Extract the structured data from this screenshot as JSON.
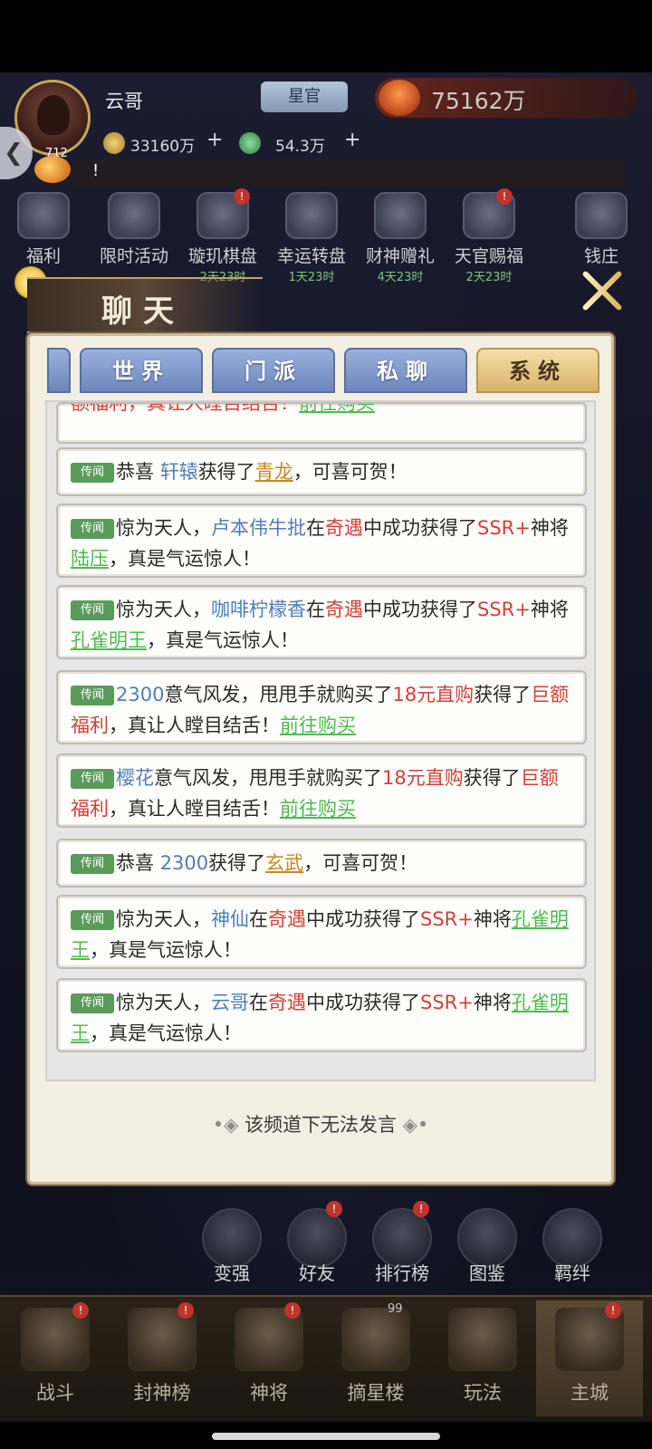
{
  "player": {
    "name": "云哥",
    "rank": "星官",
    "power": "75162万",
    "level": "712",
    "gold": "33160万",
    "jade": "54.3万",
    "marquee": "!"
  },
  "activities": [
    {
      "label": "福利",
      "timer": ""
    },
    {
      "label": "限时活动",
      "timer": ""
    },
    {
      "label": "璇玑棋盘",
      "timer": "2天23时"
    },
    {
      "label": "幸运转盘",
      "timer": "1天23时"
    },
    {
      "label": "财神赠礼",
      "timer": "4天23时"
    },
    {
      "label": "天官赐福",
      "timer": "2天23时"
    },
    {
      "label": "钱庄",
      "timer": ""
    }
  ],
  "chat": {
    "title": "聊天",
    "tabs": [
      "世界",
      "门派",
      "私聊",
      "系统"
    ],
    "active_tab": "系统",
    "tag": "传闻",
    "footer": "该频道下无法发言",
    "messages": [
      {
        "t1": "额福利，真让人瞠目结舌！",
        "link": "前往购买"
      },
      {
        "t1": "恭喜 ",
        "who": "轩辕",
        "t2": "获得了",
        "item": "青龙",
        "t3": "，可喜可贺！"
      },
      {
        "t1": "惊为天人，",
        "who": "卢本伟牛批",
        "t2": "在",
        "ev": "奇遇",
        "t3": "中成功获得了",
        "ssr": "SSR+",
        "t4": "神将",
        "item": "陆压",
        "t5": "，真是气运惊人！"
      },
      {
        "t1": "惊为天人，",
        "who": "咖啡柠檬香",
        "t2": "在",
        "ev": "奇遇",
        "t3": "中成功获得了",
        "ssr": "SSR+",
        "t4": "神将",
        "item": "孔雀明王",
        "t5": "，真是气运惊人！"
      },
      {
        "who": "2300",
        "t1": "意气风发，甩甩手就购买了",
        "pack": "18元直购",
        "t2": "获得了",
        "bonus": "巨额福利",
        "t3": "，真让人瞠目结舌！",
        "link": "前往购买"
      },
      {
        "who": "樱花",
        "t1": "意气风发，甩甩手就购买了",
        "pack": "18元直购",
        "t2": "获得了",
        "bonus": "巨额福利",
        "t3": "，真让人瞠目结舌！",
        "link": "前往购买"
      },
      {
        "t1": "恭喜 ",
        "who": "2300",
        "t2": "获得了",
        "item": "玄武",
        "t3": "，可喜可贺！"
      },
      {
        "t1": "惊为天人，",
        "who": "神仙",
        "t2": "在",
        "ev": "奇遇",
        "t3": "中成功获得了",
        "ssr": "SSR+",
        "t4": "神将",
        "item": "孔雀明王",
        "t5": "，真是气运惊人！"
      },
      {
        "t1": "惊为天人，",
        "who": "云哥",
        "t2": "在",
        "ev": "奇遇",
        "t3": "中成功获得了",
        "ssr": "SSR+",
        "t4": "神将",
        "item": "孔雀明王",
        "t5": "，真是气运惊人！"
      }
    ]
  },
  "shortcuts": [
    "变强",
    "好友",
    "排行榜",
    "图鉴",
    "羁绊"
  ],
  "nav": [
    {
      "label": "战斗"
    },
    {
      "label": "封神榜"
    },
    {
      "label": "神将"
    },
    {
      "label": "摘星楼",
      "badge": "99"
    },
    {
      "label": "玩法"
    },
    {
      "label": "主城"
    }
  ]
}
